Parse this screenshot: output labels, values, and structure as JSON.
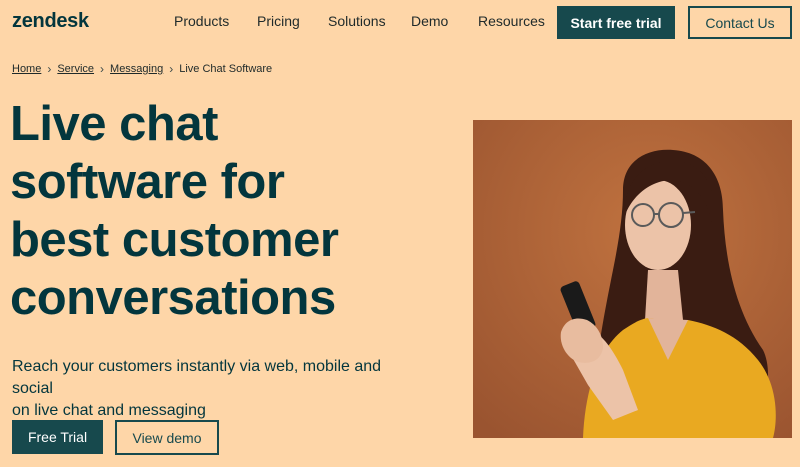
{
  "brand": {
    "logo": "zendesk"
  },
  "nav": {
    "items": [
      {
        "label": "Products"
      },
      {
        "label": "Pricing"
      },
      {
        "label": "Solutions"
      },
      {
        "label": "Demo"
      },
      {
        "label": "Resources"
      }
    ],
    "start_trial_label": "Start free trial",
    "contact_label": "Contact Us"
  },
  "breadcrumb": {
    "items": [
      {
        "label": "Home"
      },
      {
        "label": "Service"
      },
      {
        "label": "Messaging"
      },
      {
        "label": "Live Chat Software"
      }
    ]
  },
  "hero": {
    "headline_lines": [
      "Live chat",
      "software for",
      "best customer",
      "conversations"
    ],
    "subhead_lines": [
      "Reach your customers instantly via web, mobile and social",
      "on live chat and messaging"
    ],
    "primary_cta": "Free Trial",
    "secondary_cta": "View demo"
  },
  "colors": {
    "background": "#fed6a8",
    "primary": "#17494d",
    "text": "#03363d",
    "photo_background": "#b0643a",
    "shirt": "#e9a921"
  }
}
